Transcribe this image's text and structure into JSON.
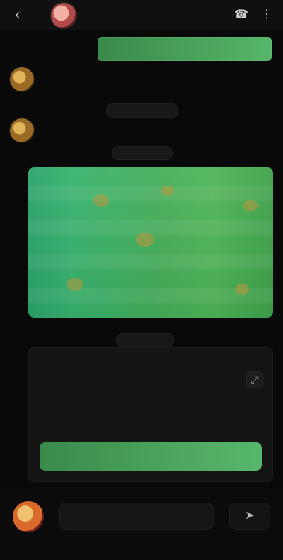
{
  "header": {
    "back_icon": "back-arrow-icon",
    "title": "",
    "subtitle": "",
    "icons": [
      "call-icon",
      "more-icon"
    ]
  },
  "chat": {
    "top_banner_text": "",
    "system_rows": [
      {
        "icon": "bot-avatar",
        "text": ""
      },
      {
        "icon": "bot-avatar",
        "text": ""
      }
    ],
    "pills": [
      {
        "text": ""
      },
      {
        "text": ""
      }
    ],
    "image_card": {
      "label": "football-field-image"
    },
    "reply_card": {
      "lines": [
        {
          "text": ""
        },
        {
          "text": ""
        },
        {
          "text": ""
        }
      ],
      "right_icon": "expand-icon",
      "action_label": ""
    }
  },
  "composer": {
    "avatar": "user-avatar",
    "input_placeholder": "",
    "send_icon": "send-icon"
  },
  "footer": {
    "left_hint": "",
    "right_hint": ""
  }
}
